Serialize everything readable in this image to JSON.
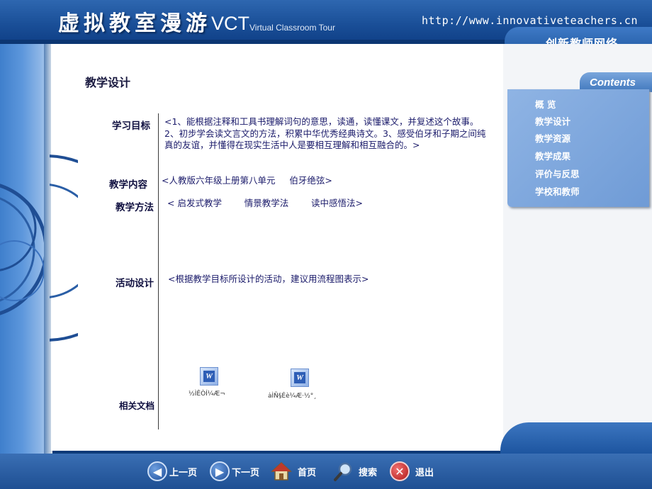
{
  "header": {
    "title_cn": "虚拟教室漫游",
    "title_abbr": "VCT",
    "title_en": "Virtual Classroom Tour",
    "url": "http://www.innovativeteachers.cn",
    "org_name": "创新教师网络"
  },
  "page": {
    "heading": "教学设计"
  },
  "fields": [
    {
      "label": "学习目标",
      "value": "<1、能根据注释和工具书理解词句的意思，读通，读懂课文，并复述这个故事。2、初步学会读文言文的方法，积累中华优秀经典诗文。3、感受伯牙和子期之间纯真的友谊，并懂得在现实生活中人是要相互理解和相互融合的。>"
    },
    {
      "label": "教学内容",
      "value": "<人教版六年级上册第八单元     伯牙绝弦>"
    },
    {
      "label": "教学方法",
      "value": "< 启发式教学        情景教学法        读中感悟法>"
    },
    {
      "label": "活动设计",
      "value": "<根据教学目标所设计的活动，建议用流程图表示>"
    },
    {
      "label": "相关文档",
      "value": ""
    }
  ],
  "documents": [
    {
      "icon": "word-document-icon",
      "label": "½ÌÊÒÍ¼Æ¬"
    },
    {
      "icon": "word-document-icon",
      "label": "ȧÌÑ§Éè¼Æ·½°¸"
    }
  ],
  "contents": {
    "title": "Contents",
    "items": [
      "概  览",
      "教学设计",
      "教学资源",
      "教学成果",
      "评价与反思",
      "学校和教师"
    ]
  },
  "nav": {
    "prev": "上一页",
    "next": "下一页",
    "home": "首页",
    "search": "搜索",
    "exit": "退出"
  },
  "colors": {
    "header_blue": "#1a4f98",
    "menu_blue": "#7aa6dc",
    "text_navy": "#1a1a6a"
  }
}
